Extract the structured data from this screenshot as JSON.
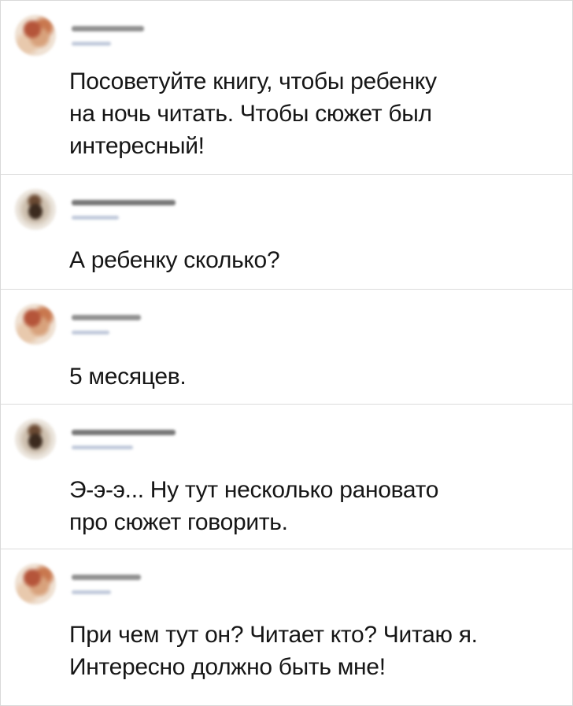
{
  "messages": [
    {
      "avatar": "warm",
      "text": "Посоветуйте книгу, чтобы ребенку\nна ночь читать. Чтобы сюжет был\nинтересный!"
    },
    {
      "avatar": "dark",
      "text": "А ребенку сколько?"
    },
    {
      "avatar": "warm",
      "text": "5 месяцев."
    },
    {
      "avatar": "dark",
      "text": "Э-э-э... Ну тут несколько рановато\nпро сюжет говорить."
    },
    {
      "avatar": "warm",
      "text": "При чем тут он? Читает кто? Читаю я.\nИнтересно должно быть мне!"
    }
  ]
}
